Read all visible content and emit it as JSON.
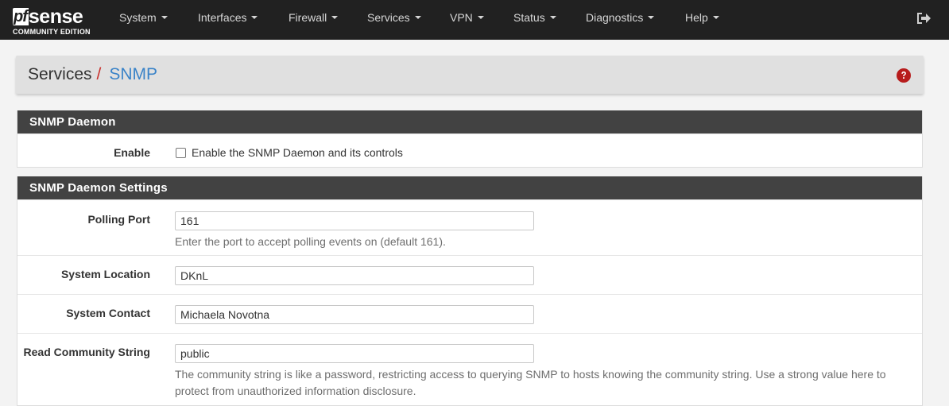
{
  "brand": {
    "logo_pf": "pf",
    "logo_sense": "sense",
    "edition": "COMMUNITY EDITION"
  },
  "nav": {
    "items": [
      {
        "label": "System"
      },
      {
        "label": "Interfaces"
      },
      {
        "label": "Firewall"
      },
      {
        "label": "Services"
      },
      {
        "label": "VPN"
      },
      {
        "label": "Status"
      },
      {
        "label": "Diagnostics"
      },
      {
        "label": "Help"
      }
    ],
    "logout_icon": "sign-out-icon"
  },
  "breadcrumb": {
    "parent": "Services",
    "separator": "/",
    "current": "SNMP",
    "help_icon": "question-circle-icon"
  },
  "panel_daemon": {
    "title": "SNMP Daemon",
    "enable_label": "Enable",
    "enable_checkbox_text": "Enable the SNMP Daemon and its controls",
    "enable_checked": false
  },
  "panel_settings": {
    "title": "SNMP Daemon Settings",
    "polling_port": {
      "label": "Polling Port",
      "value": "161",
      "help": "Enter the port to accept polling events on (default 161)."
    },
    "system_location": {
      "label": "System Location",
      "value": "DKnL"
    },
    "system_contact": {
      "label": "System Contact",
      "value": "Michaela Novotna"
    },
    "read_community": {
      "label": "Read Community String",
      "value": "public",
      "help_line1": "The community string is like a password, restricting access to querying SNMP to hosts knowing the community string. Use a strong value here to",
      "help_line2": "protect from unauthorized information disclosure."
    }
  },
  "colors": {
    "navbar": "#212121",
    "panel_heading": "#424242",
    "accent_link": "#3a83c8",
    "separator_red": "#c9302c",
    "help_red": "#c9302c"
  }
}
